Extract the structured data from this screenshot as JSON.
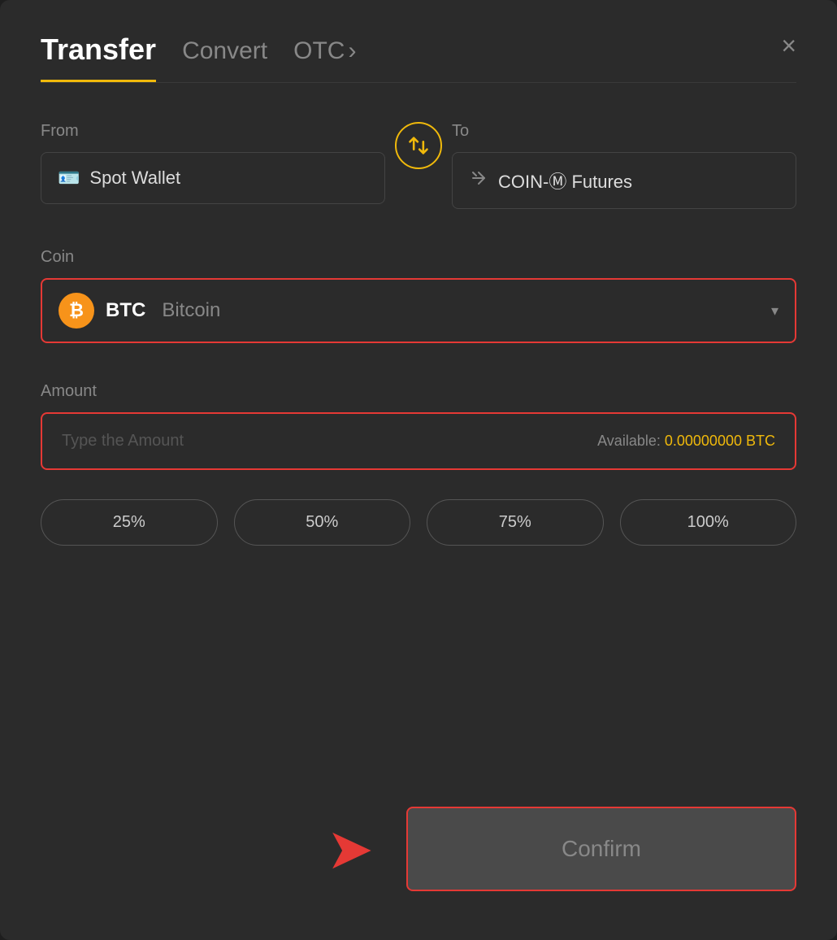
{
  "header": {
    "tab_transfer": "Transfer",
    "tab_convert": "Convert",
    "tab_otc": "OTC",
    "tab_otc_chevron": "›",
    "close_label": "×"
  },
  "from_section": {
    "label": "From",
    "wallet_name": "Spot Wallet"
  },
  "to_section": {
    "label": "To",
    "wallet_name": "COIN-Ⓜ Futures"
  },
  "coin_section": {
    "label": "Coin",
    "coin_symbol": "BTC",
    "coin_name": "Bitcoin"
  },
  "amount_section": {
    "label": "Amount",
    "placeholder": "Type the Amount",
    "available_label": "Available:",
    "available_value": "0.00000000",
    "available_unit": "BTC"
  },
  "pct_buttons": [
    "25%",
    "50%",
    "75%",
    "100%"
  ],
  "confirm_button": {
    "label": "Confirm"
  }
}
